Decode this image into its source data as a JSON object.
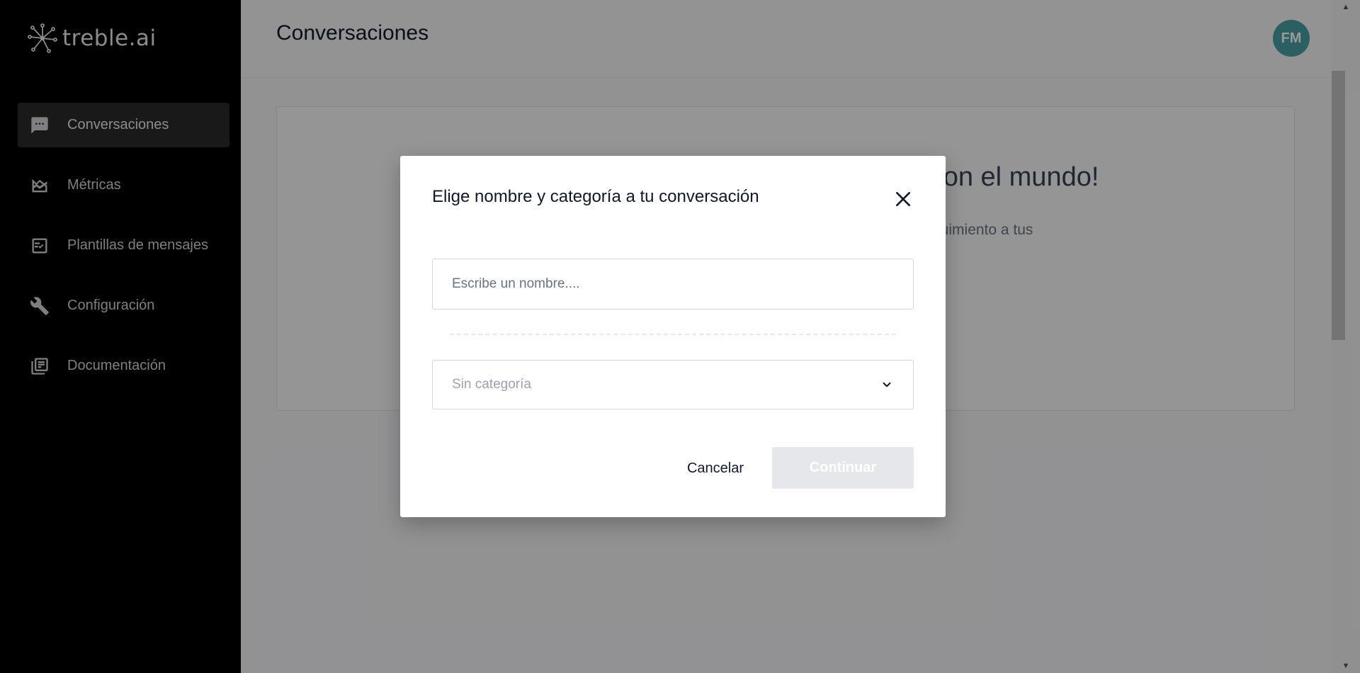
{
  "sidebar": {
    "brand": {
      "name": "treble.ai",
      "icon": "treble-logo-icon"
    },
    "items": [
      {
        "label": "Conversaciones",
        "icon": "chat-bubble-icon",
        "active": true
      },
      {
        "label": "Métricas",
        "icon": "area-chart-icon",
        "active": false
      },
      {
        "label": "Plantillas de mensajes",
        "icon": "checklist-icon",
        "active": false
      },
      {
        "label": "Configuración",
        "icon": "wrench-icon",
        "active": false
      },
      {
        "label": "Documentación",
        "icon": "library-books-icon",
        "active": false
      }
    ]
  },
  "header": {
    "title": "Conversaciones",
    "avatar_initials": "FM"
  },
  "welcome": {
    "title_visible": "a con el mundo!",
    "desc_visible": "r seguimiento a tus"
  },
  "modal": {
    "title": "Elige nombre y categoría a tu conversación",
    "name_placeholder": "Escribe un nombre....",
    "name_value": "",
    "category_selected": "Sin categoría",
    "cancel_label": "Cancelar",
    "continue_label": "Continuar"
  },
  "colors": {
    "sidebar_bg": "#000000",
    "sidebar_active": "#2b2b2b",
    "avatar_bg": "#4a9fa3",
    "continue_disabled_bg": "#e5e7eb",
    "overlay": "rgba(0,0,0,0.4)"
  }
}
